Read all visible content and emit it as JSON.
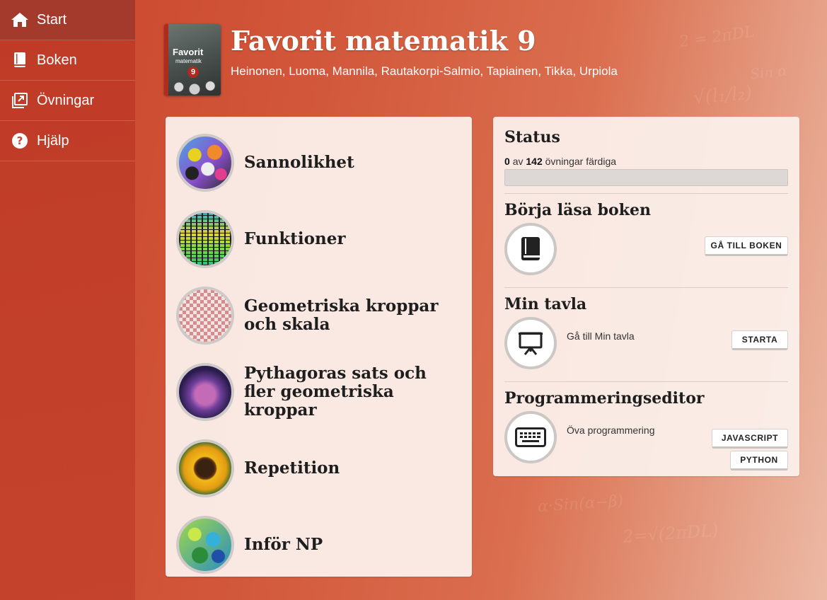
{
  "sidebar": {
    "items": [
      {
        "label": "Start",
        "icon": "home-icon",
        "active": true
      },
      {
        "label": "Boken",
        "icon": "book-icon",
        "active": false
      },
      {
        "label": "Övningar",
        "icon": "exercises-icon",
        "active": false
      },
      {
        "label": "Hjälp",
        "icon": "help-icon",
        "active": false
      }
    ]
  },
  "header": {
    "cover": {
      "title": "Favorit",
      "subtitle": "matematik",
      "number": "9"
    },
    "title": "Favorit matematik 9",
    "authors": "Heinonen, Luoma, Mannila, Rautakorpi-Salmio, Tapiainen, Tikka, Urpiola"
  },
  "chapters": [
    {
      "label": "Sannolikhet",
      "thumb": "dice"
    },
    {
      "label": "Funktioner",
      "thumb": "equalizer"
    },
    {
      "label": "Geometriska kroppar och skala",
      "thumb": "bowling-pins"
    },
    {
      "label": "Pythagoras sats och fler geometriska kroppar",
      "thumb": "city-sphere"
    },
    {
      "label": "Repetition",
      "thumb": "sunflower"
    },
    {
      "label": "Inför NP",
      "thumb": "marbles"
    }
  ],
  "status": {
    "title": "Status",
    "done": "0",
    "of": "av",
    "total": "142",
    "suffix": "övningar färdiga",
    "progress_fraction": 0
  },
  "read_book": {
    "title": "Börja läsa boken",
    "button": "GÅ TILL BOKEN",
    "icon": "book-icon"
  },
  "board": {
    "title": "Min tavla",
    "desc": "Gå till Min tavla",
    "button": "STARTA",
    "icon": "presentation-icon"
  },
  "editor": {
    "title": "Programmeringseditor",
    "desc": "Öva programmering",
    "buttons": [
      "JAVASCRIPT",
      "PYTHON"
    ],
    "icon": "keyboard-icon"
  }
}
